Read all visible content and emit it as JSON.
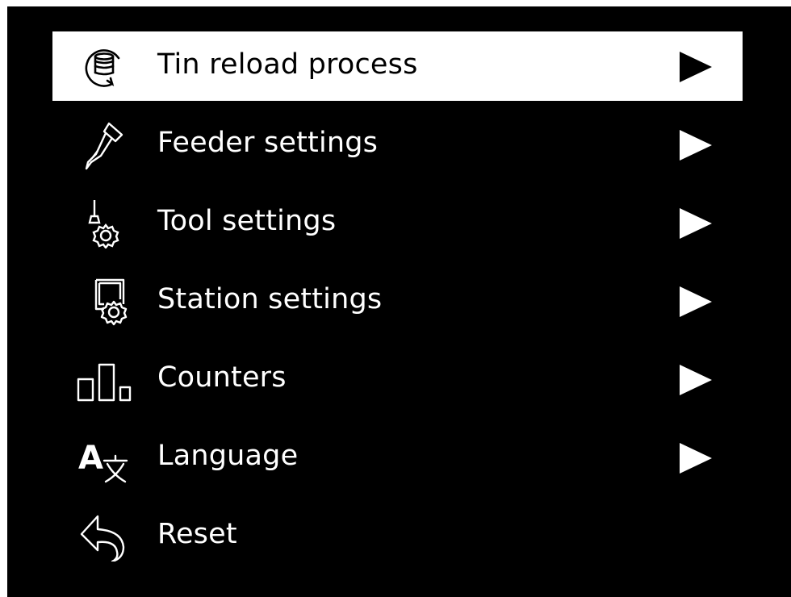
{
  "menu": {
    "items": [
      {
        "label": "Tin reload process",
        "icon": "tin-reload-icon",
        "has_submenu": true,
        "selected": true
      },
      {
        "label": "Feeder settings",
        "icon": "feeder-icon",
        "has_submenu": true,
        "selected": false
      },
      {
        "label": "Tool settings",
        "icon": "tool-settings-icon",
        "has_submenu": true,
        "selected": false
      },
      {
        "label": "Station settings",
        "icon": "station-settings-icon",
        "has_submenu": true,
        "selected": false
      },
      {
        "label": "Counters",
        "icon": "counters-icon",
        "has_submenu": true,
        "selected": false
      },
      {
        "label": "Language",
        "icon": "language-icon",
        "has_submenu": true,
        "selected": false
      },
      {
        "label": "Reset",
        "icon": "reset-icon",
        "has_submenu": false,
        "selected": false
      }
    ]
  },
  "colors": {
    "background": "#000000",
    "foreground": "#ffffff",
    "selected_background": "#ffffff",
    "selected_foreground": "#000000"
  }
}
